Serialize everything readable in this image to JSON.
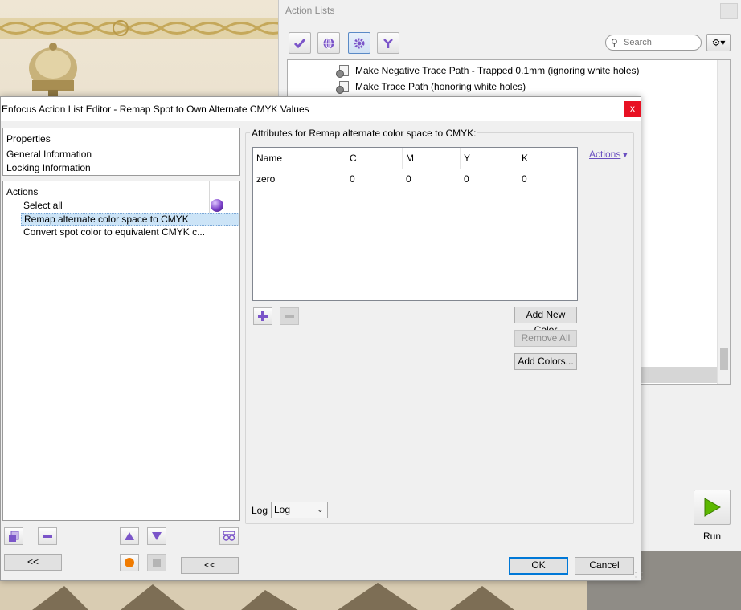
{
  "action_lists": {
    "title": "Action Lists",
    "search": {
      "placeholder": "Search"
    },
    "items": [
      {
        "label": "Make Negative Trace Path - Trapped 0.1mm (ignoring white holes)"
      },
      {
        "label": "Make Trace Path (honoring white holes)"
      }
    ],
    "run_label": "Run"
  },
  "editor": {
    "title": "Enfocus Action List Editor - Remap Spot to Own Alternate CMYK Values",
    "close_glyph": "x",
    "properties": {
      "header": "Properties",
      "items": [
        "General Information",
        "Locking Information"
      ]
    },
    "actions": {
      "header": "Actions",
      "items": [
        {
          "label": "Select all",
          "selected": false
        },
        {
          "label": "Remap alternate color space to CMYK",
          "selected": true
        },
        {
          "label": "Convert spot color to equivalent CMYK c...",
          "selected": false
        }
      ]
    },
    "collapse_left_label": "<<",
    "collapse_right_label": "<<",
    "attributes": {
      "title": "Attributes for Remap alternate color space to CMYK:",
      "actions_link": "Actions",
      "columns": [
        "Name",
        "C",
        "M",
        "Y",
        "K"
      ],
      "rows": [
        [
          "zero",
          "0",
          "0",
          "0",
          "0"
        ]
      ],
      "add_new_color_label": "Add New Color",
      "remove_all_label": "Remove All",
      "add_colors_label": "Add Colors...",
      "log_label": "Log",
      "log_value": "Log"
    },
    "ok_label": "OK",
    "cancel_label": "Cancel"
  },
  "colors": {
    "accent_purple": "#7b55c9",
    "selection_blue": "#cce4f7",
    "close_red": "#e81123",
    "run_green": "#5cb800"
  }
}
